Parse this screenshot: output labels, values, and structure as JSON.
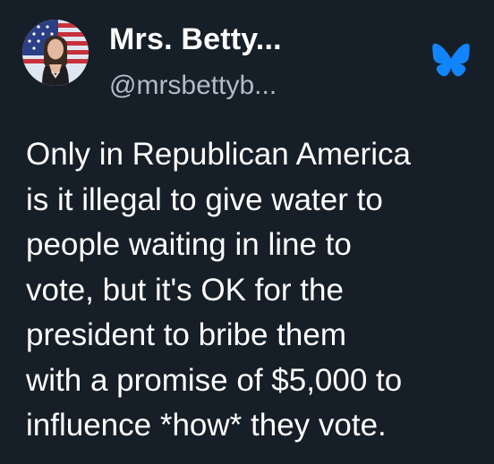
{
  "author": {
    "display_name": "Mrs. Betty...",
    "handle": "@mrsbettyb...",
    "avatar_icon": "profile-photo-flag-background"
  },
  "platform_icon": "bluesky-butterfly-icon",
  "post": {
    "text": "Only in Republican America\nis it illegal to give water to\npeople waiting in line to\nvote, but it's OK for the\npresident to bribe them\nwith a promise of $5,000 to\ninfluence *how* they vote."
  },
  "colors": {
    "background": "#161e27",
    "text": "#ffffff",
    "handle": "#b3bbc6",
    "bluesky": "#1185fe"
  }
}
